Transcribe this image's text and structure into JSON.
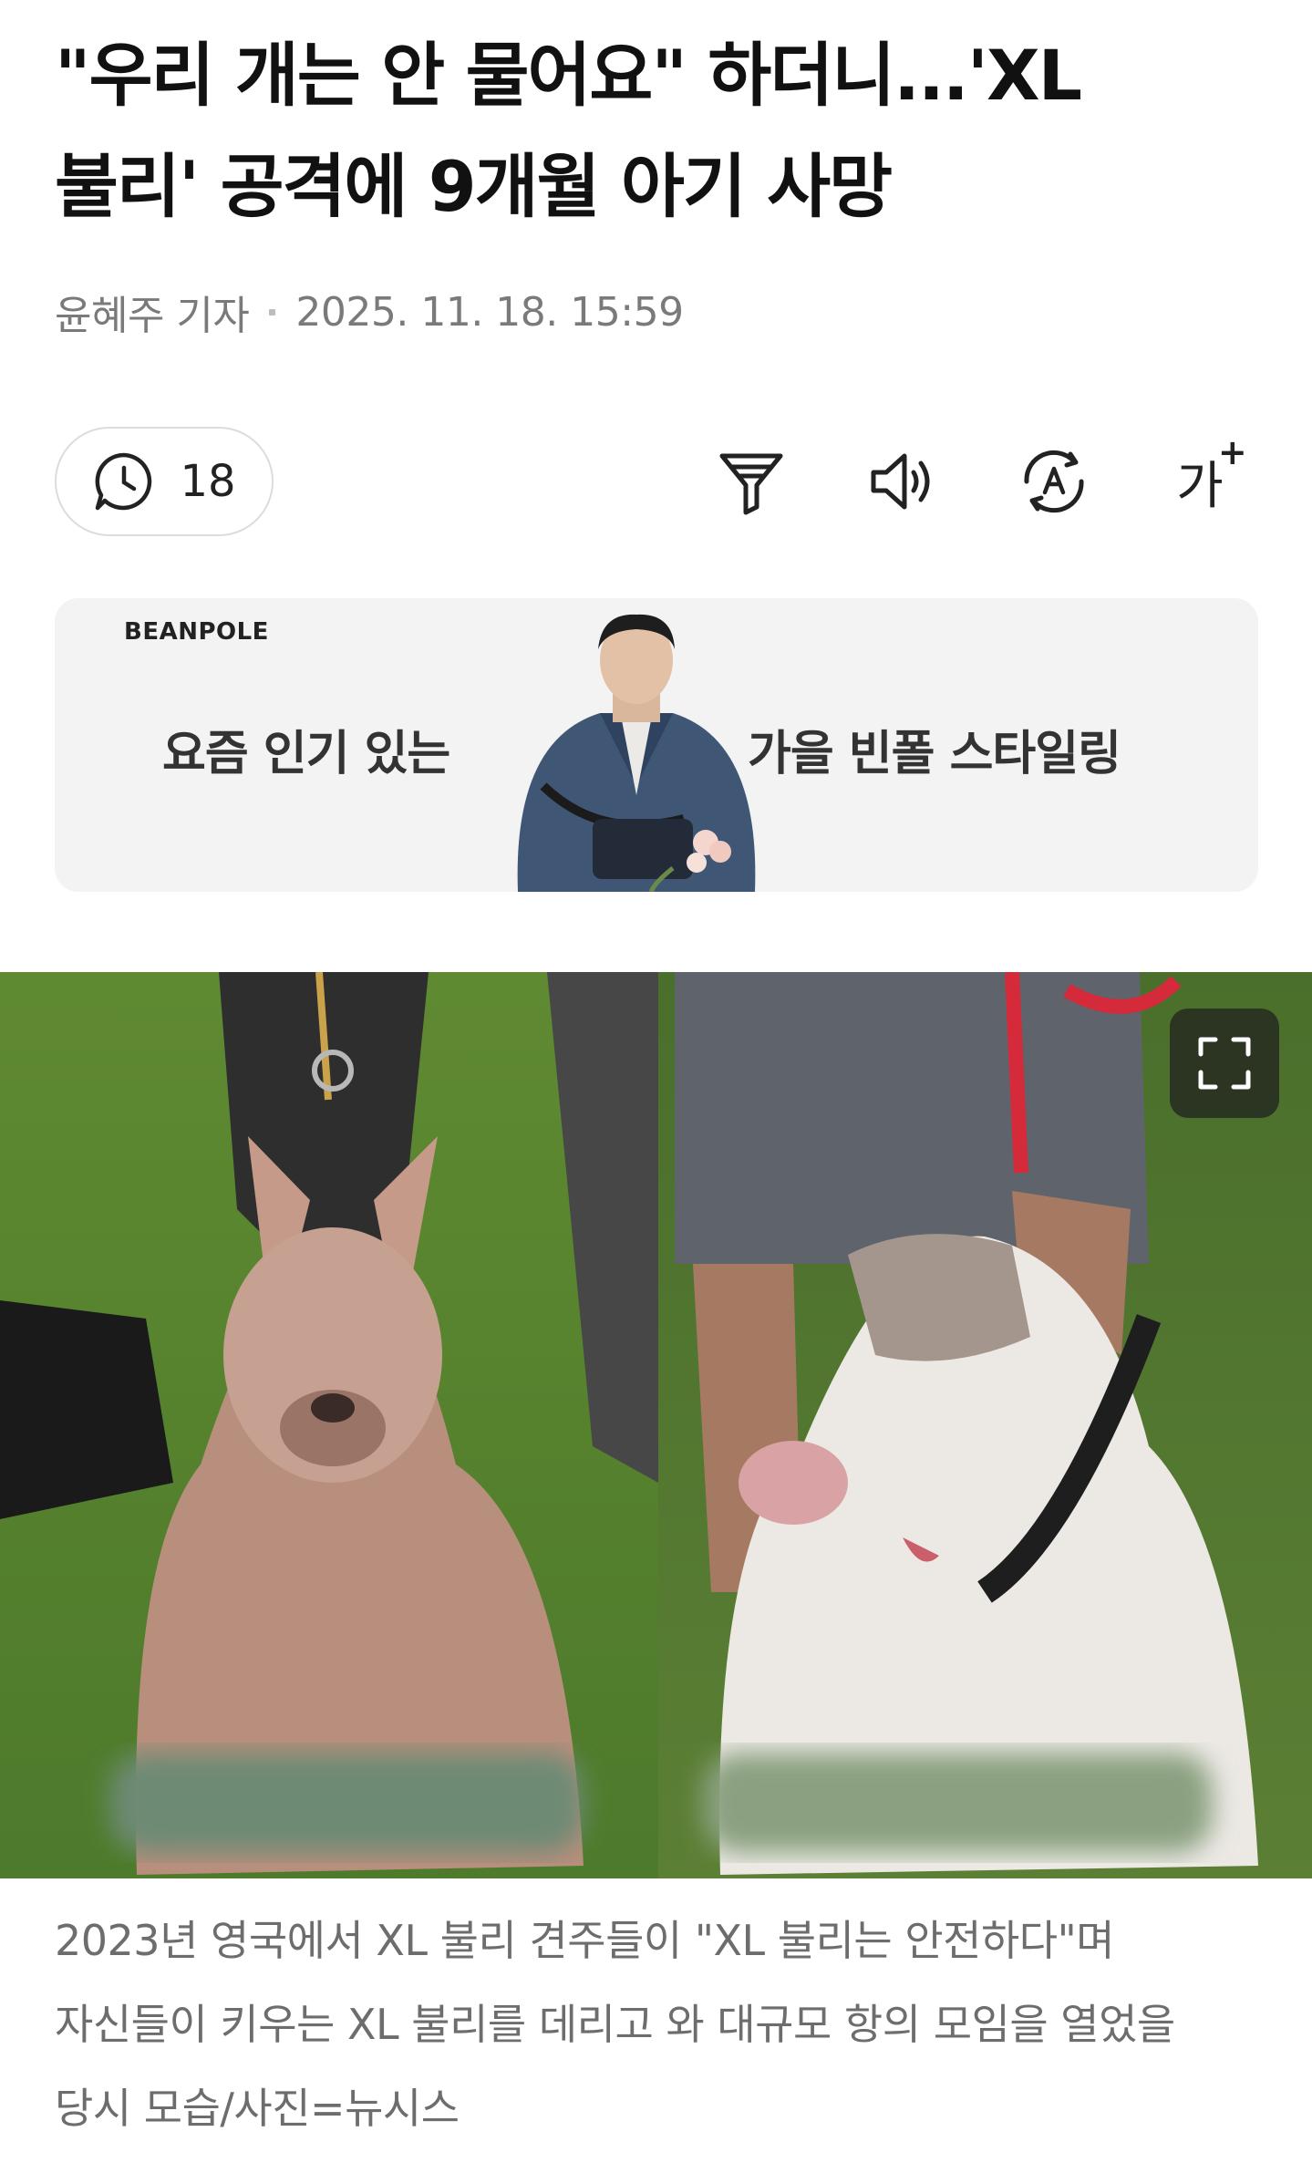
{
  "article": {
    "headline_line1": "\"우리 개는 안 물어요\" 하더니...'XL",
    "headline_line2": "불리' 공격에 9개월 아기 사망",
    "reporter": "윤혜주 기자",
    "datetime": "2025. 11. 18. 15:59"
  },
  "toolbar": {
    "comment_count": "18",
    "icons": [
      "comment-clock-icon",
      "filter-icon",
      "speaker-icon",
      "translate-icon",
      "font-size-icon"
    ],
    "font_size_label": "가",
    "font_size_plus": "+"
  },
  "ad": {
    "brand": "BEANPOLE",
    "left_text": "요즘 인기 있는",
    "right_text": "가을 빈폴 스타일링"
  },
  "photo": {
    "expand_icon": "fullscreen-icon",
    "caption_lines": [
      "2023년 영국에서 XL 불리 견주들이 \"XL 불리는 안전하다\"며",
      "자신들이 키우는 XL 불리를 데리고 와 대규모 항의 모임을 열었을",
      "당시 모습/사진=뉴시스"
    ]
  },
  "colors": {
    "text_primary": "#111111",
    "text_secondary": "#7a7a7a",
    "ad_background": "#f3f3f3",
    "pill_border": "#dcdcdc"
  }
}
